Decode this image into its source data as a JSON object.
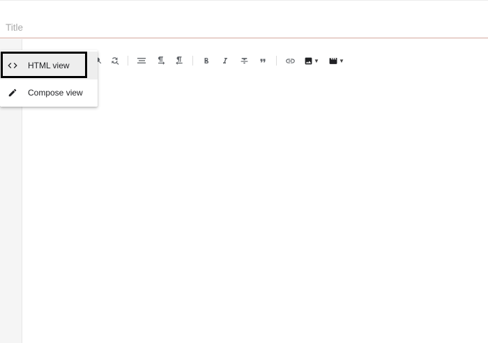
{
  "title": {
    "placeholder": "Title",
    "value": ""
  },
  "mode_menu": {
    "items": [
      {
        "label": "HTML view",
        "icon": "code-icon",
        "selected": true
      },
      {
        "label": "Compose view",
        "icon": "pencil-icon",
        "selected": false
      }
    ]
  },
  "toolbar": {
    "buttons": [
      {
        "name": "search-replace-button",
        "icon": "find-replace-icon"
      },
      {
        "name": "align-button",
        "icon": "align-left-icon"
      },
      {
        "name": "paragraph-ltr-button",
        "icon": "paragraph-ltr-icon"
      },
      {
        "name": "paragraph-rtl-button",
        "icon": "paragraph-rtl-icon"
      },
      {
        "name": "bold-button",
        "icon": "bold-icon"
      },
      {
        "name": "italic-button",
        "icon": "italic-icon"
      },
      {
        "name": "strikethrough-button",
        "icon": "strikethrough-icon"
      },
      {
        "name": "quote-button",
        "icon": "quote-icon"
      },
      {
        "name": "link-button",
        "icon": "link-icon"
      },
      {
        "name": "insert-image-button",
        "icon": "image-icon"
      },
      {
        "name": "insert-video-button",
        "icon": "video-icon"
      }
    ]
  },
  "colors": {
    "title_underline": "#d4a79c",
    "menu_selected_bg": "#eeeeee",
    "highlight_border": "#000000",
    "gutter_bg": "#f5f5f5",
    "icon_color": "#5f6368"
  }
}
